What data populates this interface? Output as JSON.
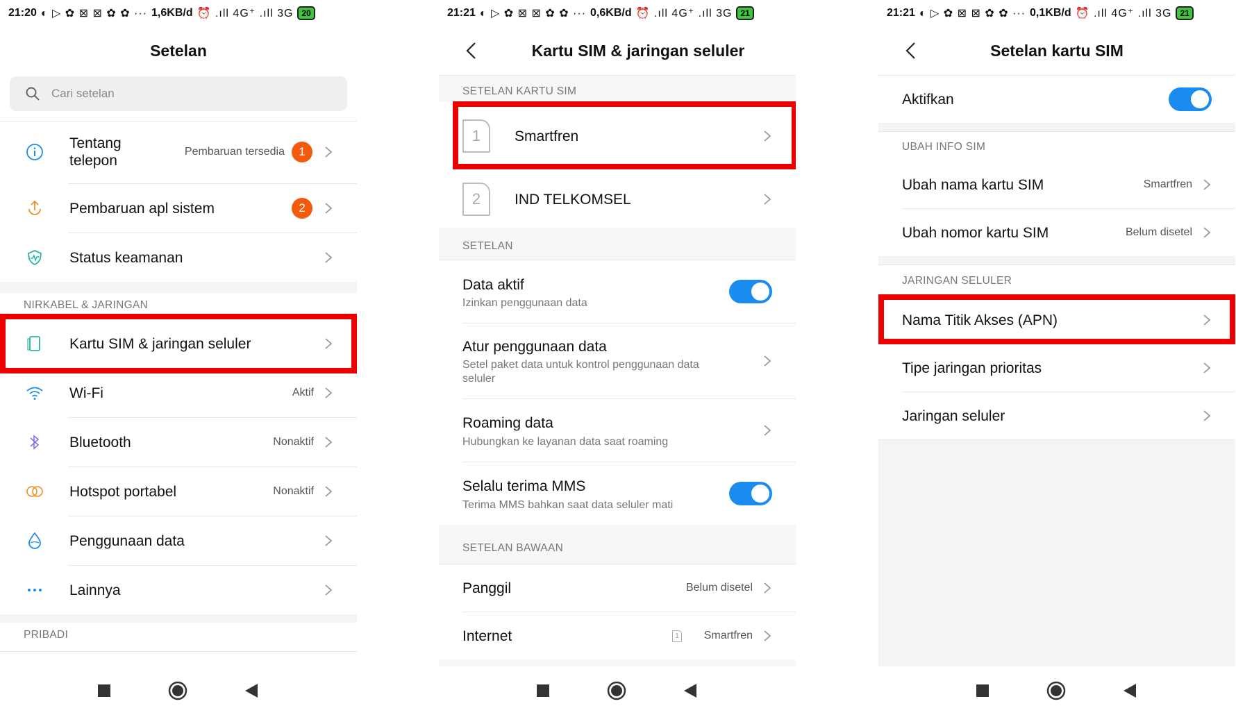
{
  "status_bars": [
    {
      "time": "21:20",
      "icons": "◐ ▷ ✿ ⊠ ⊠ ✿ ✿  ···",
      "speed": "1,6KB/d",
      "network": "⏰ .ıll 4G⁺ .ıll 3G",
      "battery": "20"
    },
    {
      "time": "21:21",
      "icons": "◐ ▷ ✿ ⊠ ⊠ ✿ ✿  ···",
      "speed": "0,6KB/d",
      "network": "⏰ .ıll 4G⁺ .ıll 3G",
      "battery": "21"
    },
    {
      "time": "21:21",
      "icons": "◐ ▷ ✿ ⊠ ⊠ ✿ ✿  ···",
      "speed": "0,1KB/d",
      "network": "⏰ .ıll 4G⁺ .ıll 3G",
      "battery": "21"
    }
  ],
  "screen1": {
    "title": "Setelan",
    "search_placeholder": "Cari setelan",
    "items_top": [
      {
        "label": "Tentang telepon",
        "value": "Pembaruan tersedia",
        "badge": "1"
      },
      {
        "label": "Pembaruan apl sistem",
        "value": "",
        "badge": "2"
      },
      {
        "label": "Status keamanan",
        "value": "",
        "badge": ""
      }
    ],
    "section_wireless": "NIRKABEL & JARINGAN",
    "items_wireless": [
      {
        "label": "Kartu SIM & jaringan seluler",
        "value": ""
      },
      {
        "label": "Wi-Fi",
        "value": "Aktif"
      },
      {
        "label": "Bluetooth",
        "value": "Nonaktif"
      },
      {
        "label": "Hotspot portabel",
        "value": "Nonaktif"
      },
      {
        "label": "Penggunaan data",
        "value": ""
      },
      {
        "label": "Lainnya",
        "value": ""
      }
    ],
    "section_personal": "PRIBADI"
  },
  "screen2": {
    "title": "Kartu SIM & jaringan seluler",
    "section_sim": "SETELAN KARTU SIM",
    "sims": [
      {
        "slot": "1",
        "name": "Smartfren"
      },
      {
        "slot": "2",
        "name": "IND TELKOMSEL"
      }
    ],
    "section_settings": "SETELAN",
    "settings": [
      {
        "label": "Data aktif",
        "sub": "Izinkan penggunaan data"
      },
      {
        "label": "Atur penggunaan data",
        "sub": "Setel paket data untuk kontrol penggunaan data seluler"
      },
      {
        "label": "Roaming data",
        "sub": "Hubungkan ke layanan data saat roaming"
      },
      {
        "label": "Selalu terima MMS",
        "sub": "Terima MMS bahkan saat data seluler mati"
      }
    ],
    "section_default": "SETELAN BAWAAN",
    "defaults": [
      {
        "label": "Panggil",
        "value": "Belum disetel"
      },
      {
        "label": "Internet",
        "value": "Smartfren",
        "slot": "1"
      }
    ]
  },
  "screen3": {
    "title": "Setelan kartu SIM",
    "activate_label": "Aktifkan",
    "section_info": "UBAH INFO SIM",
    "info_items": [
      {
        "label": "Ubah nama kartu SIM",
        "value": "Smartfren"
      },
      {
        "label": "Ubah nomor kartu SIM",
        "value": "Belum disetel"
      }
    ],
    "section_network": "JARINGAN SELULER",
    "network_items": [
      {
        "label": "Nama Titik Akses (APN)"
      },
      {
        "label": "Tipe jaringan prioritas"
      },
      {
        "label": "Jaringan seluler"
      }
    ]
  },
  "colors": {
    "accent": "#1a8cf0",
    "highlight": "#ee0000",
    "badge": "#f25a0d"
  }
}
